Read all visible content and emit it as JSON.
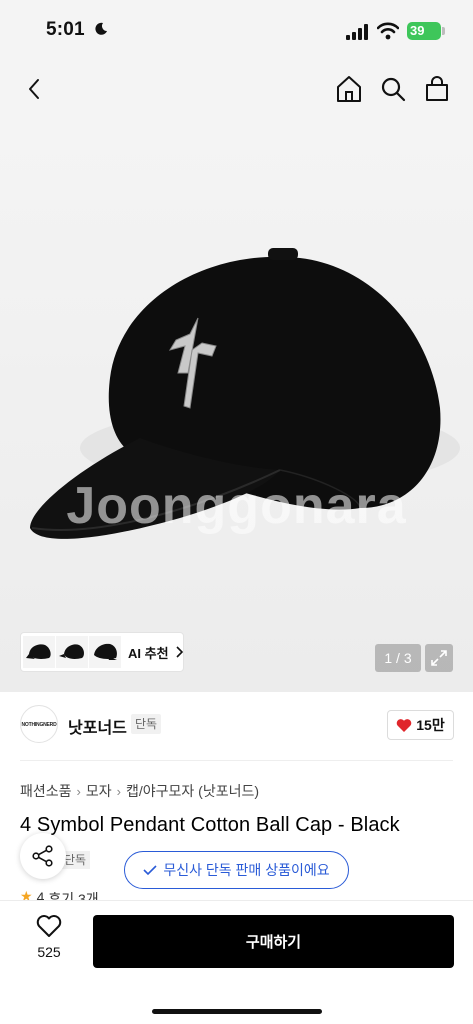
{
  "status_bar": {
    "time": "5:01",
    "battery": "39"
  },
  "header": {
    "icons": [
      "chevron-left-icon",
      "home-icon",
      "search-icon",
      "shopping-bag-icon"
    ]
  },
  "hero": {
    "watermark": "Joonggonara",
    "ai_recommend_label": "AI 추천",
    "pager": "1 / 3"
  },
  "brand": {
    "logo_text": "NOTHINGNERD",
    "name": "낫포너드",
    "badge": "단독",
    "likes": "15만"
  },
  "breadcrumb": [
    "패션소품",
    "모자",
    "캡/야구모자 (낫포너드)"
  ],
  "product": {
    "title": "4 Symbol Pendant Cotton Ball Cap - Black",
    "exclusive_tag": "단독",
    "exclusive_notice": "무신사 단독 판매 상품이에요",
    "rating": "4",
    "reviews": "후기 3개"
  },
  "bottom_bar": {
    "wish_count": "525",
    "buy_label": "구매하기"
  },
  "colors": {
    "accent": "#2a5bd7",
    "like": "#e0262b",
    "buy_button": "#000000",
    "battery": "#3ec65a"
  }
}
